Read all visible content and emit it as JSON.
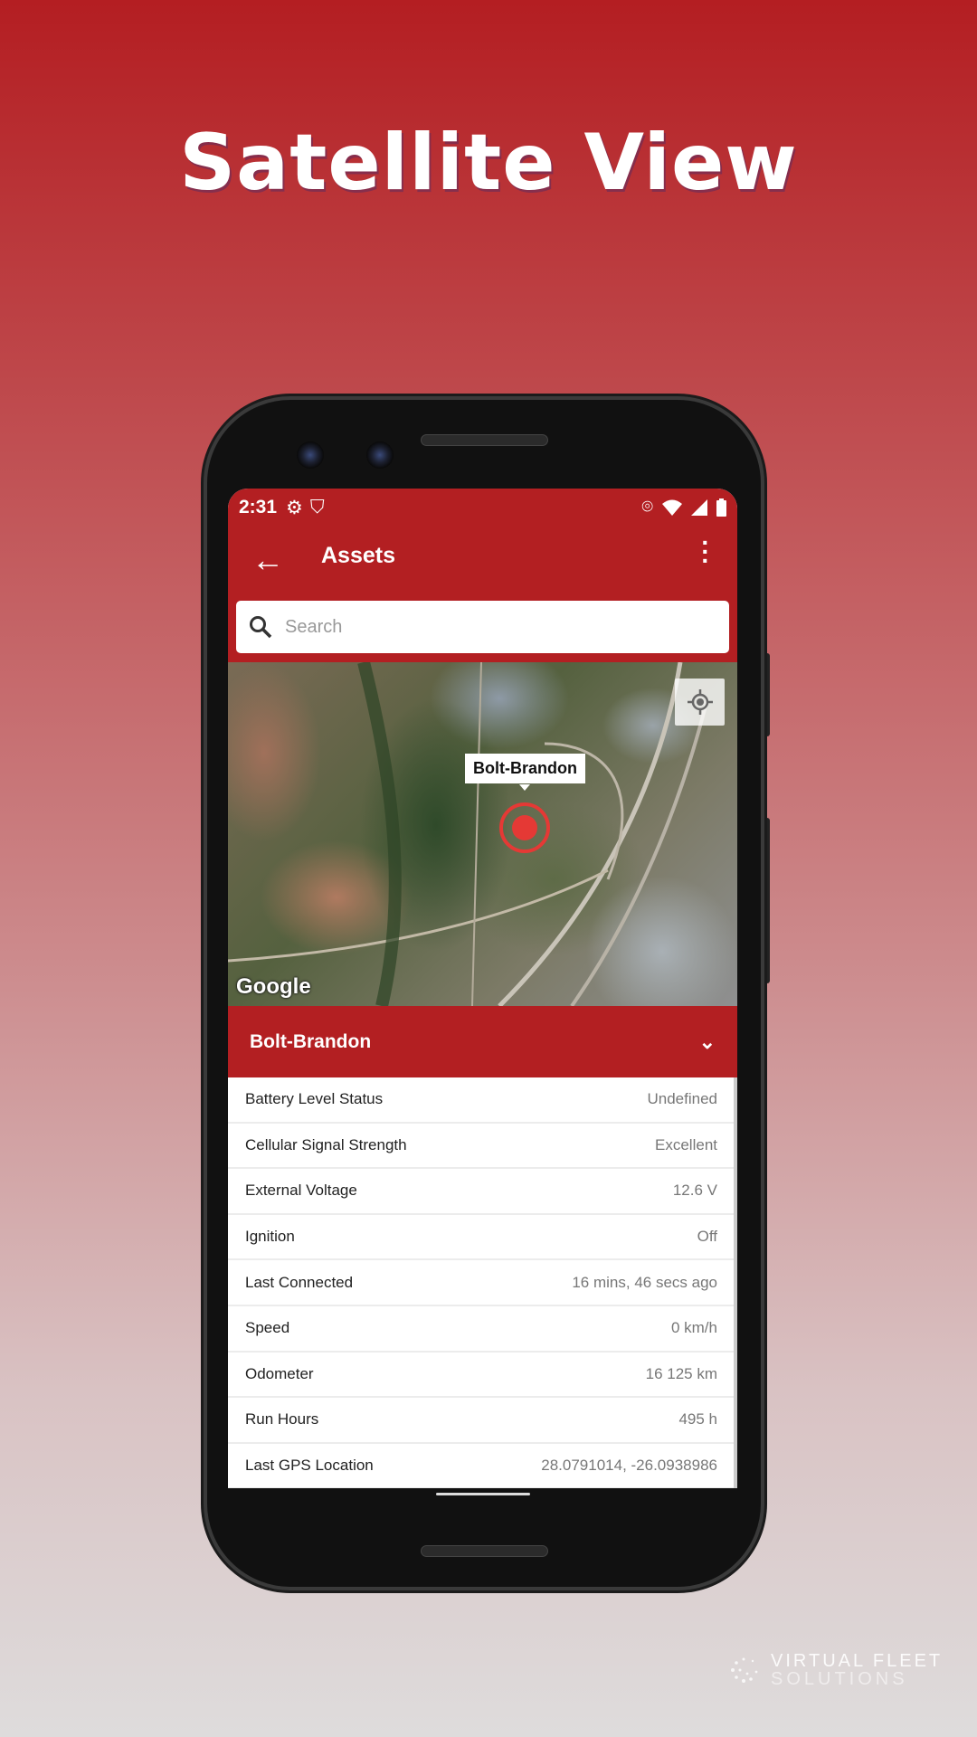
{
  "headline": "Satellite View",
  "status_bar": {
    "time": "2:31",
    "icons": [
      "gear-icon",
      "shield-play-icon",
      "location-icon",
      "wifi-icon",
      "signal-icon",
      "battery-icon"
    ]
  },
  "app_bar": {
    "title": "Assets",
    "back_icon": "arrow-left-icon",
    "menu_icon": "more-vertical-icon"
  },
  "search": {
    "placeholder": "Search",
    "value": ""
  },
  "map": {
    "type": "satellite",
    "marker_label": "Bolt-Brandon",
    "attribution": "Google",
    "locate_icon": "my-location-icon",
    "marker_color": "#e53935"
  },
  "panel": {
    "title": "Bolt-Brandon",
    "rows": [
      {
        "label": "Battery Level Status",
        "value": "Undefined"
      },
      {
        "label": "Cellular Signal Strength",
        "value": "Excellent"
      },
      {
        "label": "External Voltage",
        "value": "12.6 V"
      },
      {
        "label": "Ignition",
        "value": "Off"
      },
      {
        "label": "Last Connected",
        "value": "16 mins, 46 secs ago"
      },
      {
        "label": "Speed",
        "value": "0 km/h"
      },
      {
        "label": "Odometer",
        "value": "16 125 km"
      },
      {
        "label": "Run Hours",
        "value": "495 h"
      },
      {
        "label": "Last GPS Location",
        "value": "28.0791014, -26.0938986"
      }
    ]
  },
  "brand": {
    "line1": "VIRTUAL FLEET",
    "line2": "SOLUTIONS"
  },
  "colors": {
    "primary": "#b31f22",
    "background_top": "#b41e22",
    "background_bottom": "#dedcdc"
  }
}
